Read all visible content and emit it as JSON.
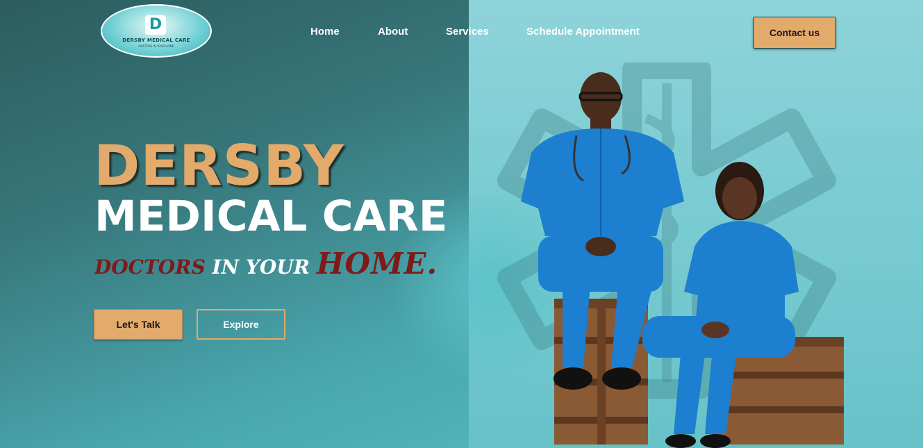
{
  "logo": {
    "mark": "D",
    "title": "DERSBY MEDICAL CARE",
    "tagline": "DOCTORS IN YOUR HOME"
  },
  "nav": {
    "items": [
      {
        "label": "Home"
      },
      {
        "label": "About"
      },
      {
        "label": "Services"
      },
      {
        "label": "Schedule Appointment"
      }
    ],
    "contact_label": "Contact us"
  },
  "hero": {
    "title_line1": "DERSBY",
    "title_line2": "MEDICAL CARE",
    "tagline_part1": "DOCTORS",
    "tagline_part2": " IN YOUR ",
    "tagline_part3": "HOME."
  },
  "buttons": {
    "talk_label": "Let's Talk",
    "explore_label": "Explore"
  },
  "colors": {
    "accent": "#e2aa6b",
    "dark_teal": "#2c5d5f",
    "light_teal": "#7ccdd3",
    "tagline_red": "#7f1a1a",
    "scrub_blue": "#1c7fd0"
  }
}
